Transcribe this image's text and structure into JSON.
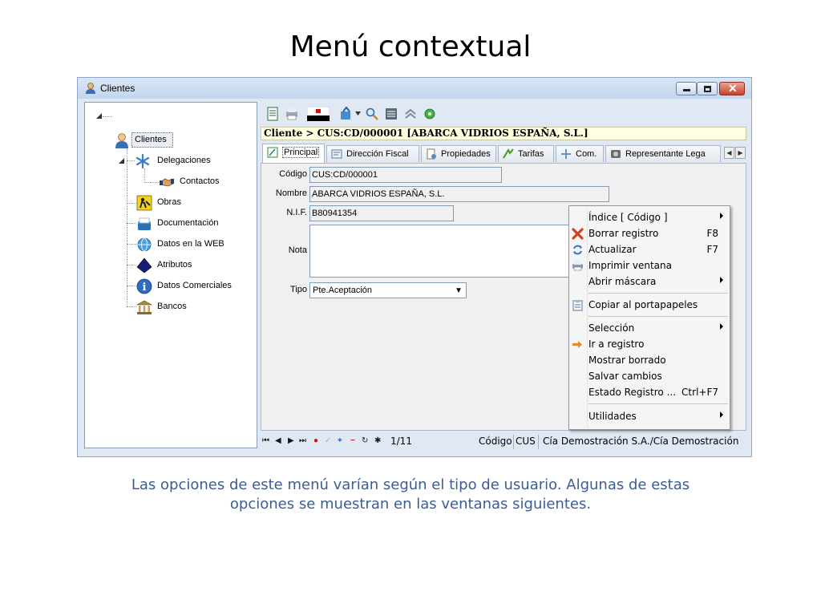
{
  "slide": {
    "title": "Menú contextual",
    "caption_line1": "Las opciones de este menú varían según el tipo de usuario. Algunas de estas",
    "caption_line2": "opciones se muestran en las ventanas siguientes."
  },
  "window": {
    "title": "Clientes"
  },
  "tree": {
    "items": [
      {
        "label": "Clientes",
        "icon": "user-icon"
      },
      {
        "label": "Delegaciones",
        "icon": "asterisk-icon"
      },
      {
        "label": "Contactos",
        "icon": "handshake-icon"
      },
      {
        "label": "Obras",
        "icon": "construction-icon"
      },
      {
        "label": "Documentación",
        "icon": "folder-icon"
      },
      {
        "label": "Datos en la WEB",
        "icon": "globe-icon"
      },
      {
        "label": "Atributos",
        "icon": "diamond-icon"
      },
      {
        "label": "Datos Comerciales",
        "icon": "info-icon"
      },
      {
        "label": "Bancos",
        "icon": "bank-icon"
      }
    ]
  },
  "breadcrumb": "Cliente > CUS:CD/000001 [ABARCA VIDRIOS ESPAÑA, S.L.]",
  "tabs": [
    {
      "label": "Principal"
    },
    {
      "label": "Dirección Fiscal"
    },
    {
      "label": "Propiedades"
    },
    {
      "label": "Tarifas"
    },
    {
      "label": "Com."
    },
    {
      "label": "Representante Lega"
    }
  ],
  "form": {
    "codigo_label": "Código",
    "codigo_value": "CUS:CD/000001",
    "nombre_label": "Nombre",
    "nombre_value": "ABARCA VIDRIOS ESPAÑA, S.L.",
    "nif_label": "N.I.F.",
    "nif_value": "B80941354",
    "nota_label": "Nota",
    "tipo_label": "Tipo",
    "tipo_value": "Pte.Aceptación"
  },
  "statusbar": {
    "record": "1/11",
    "codigo_label": "Código",
    "codigo_value": "CUS",
    "company": "Cía Demostración S.A./Cía Demostración"
  },
  "context_menu": {
    "indice": "Índice  [  Código  ]",
    "borrar": "Borrar registro",
    "borrar_shortcut": "F8",
    "actualizar": "Actualizar",
    "actualizar_shortcut": "F7",
    "imprimir": "Imprimir ventana",
    "abrir": "Abrir máscara",
    "copiar": "Copiar al portapapeles",
    "seleccion": "Selección",
    "ir": "Ir a registro",
    "mostrar": "Mostrar borrado",
    "salvar": "Salvar cambios",
    "estado": "Estado Registro ...",
    "estado_shortcut": "Ctrl+F7",
    "utilidades": "Utilidades"
  },
  "colors": {
    "caption": "#3a5d96",
    "breadcrumb_bg": "#ffffe1",
    "window_frame": "#dfe8f3"
  }
}
